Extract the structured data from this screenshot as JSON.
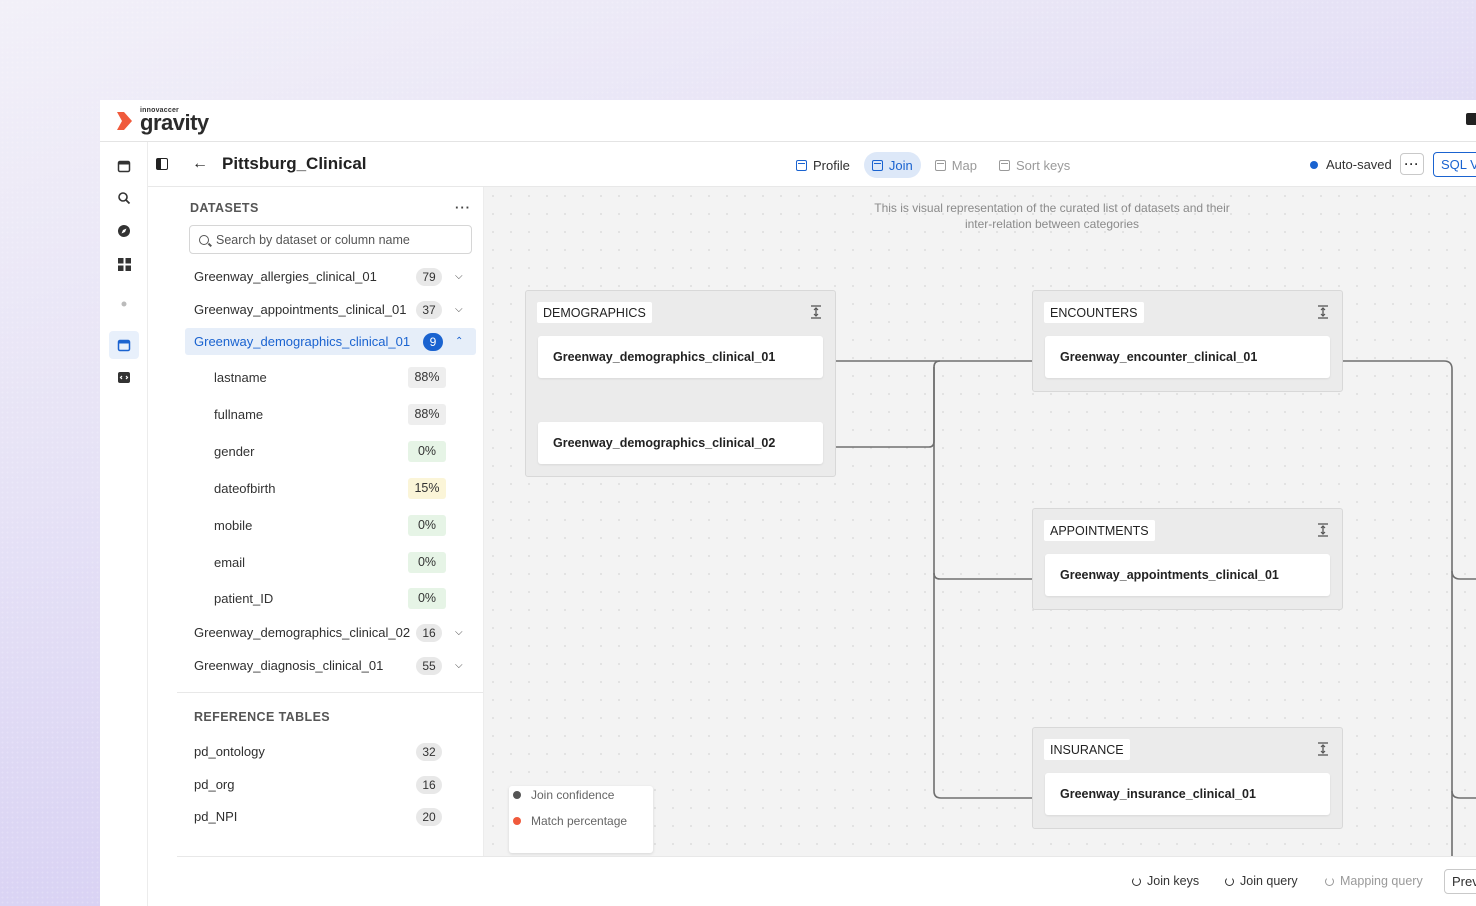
{
  "brand": {
    "small": "innovaccer",
    "name": "gravity",
    "accent": "#f05a3c"
  },
  "header": {
    "title": "Pittsburg_Clinical",
    "tabs": [
      {
        "label": "Profile",
        "state": "normal"
      },
      {
        "label": "Join",
        "state": "active"
      },
      {
        "label": "Map",
        "state": "disabled"
      },
      {
        "label": "Sort keys",
        "state": "disabled"
      }
    ],
    "status": "Auto-saved",
    "more": "···",
    "sql_button": "SQL V"
  },
  "datasets": {
    "title": "DATASETS",
    "menu": "···",
    "search_placeholder": "Search by dataset or column name",
    "items": [
      {
        "name": "Greenway_allergies_clinical_01",
        "count": "79"
      },
      {
        "name": "Greenway_appointments_clinical_01",
        "count": "37"
      },
      {
        "name": "Greenway_demographics_clinical_01",
        "count": "9"
      },
      {
        "name": "Greenway_demographics_clinical_02",
        "count": "16"
      },
      {
        "name": "Greenway_diagnosis_clinical_01",
        "count": "55"
      }
    ],
    "columns": [
      {
        "name": "lastname",
        "pct": "88%"
      },
      {
        "name": "fullname",
        "pct": "88%"
      },
      {
        "name": "gender",
        "pct": "0%"
      },
      {
        "name": "dateofbirth",
        "pct": "15%"
      },
      {
        "name": "mobile",
        "pct": "0%"
      },
      {
        "name": "email",
        "pct": "0%"
      },
      {
        "name": "patient_ID",
        "pct": "0%"
      }
    ]
  },
  "reference": {
    "title": "REFERENCE TABLES",
    "items": [
      {
        "name": "pd_ontology",
        "count": "32"
      },
      {
        "name": "pd_org",
        "count": "16"
      },
      {
        "name": "pd_NPI",
        "count": "20"
      }
    ]
  },
  "canvas": {
    "description": "This is visual representation of the curated list of datasets and their inter-relation between categories",
    "groups": [
      {
        "label": "DEMOGRAPHICS",
        "tables": [
          "Greenway_demographics_clinical_01",
          "Greenway_demographics_clinical_02"
        ]
      },
      {
        "label": "ENCOUNTERS",
        "tables": [
          "Greenway_encounter_clinical_01"
        ]
      },
      {
        "label": "APPOINTMENTS",
        "tables": [
          "Greenway_appointments_clinical_01"
        ]
      },
      {
        "label": "INSURANCE",
        "tables": [
          "Greenway_insurance_clinical_01"
        ]
      }
    ],
    "legend": [
      {
        "label": "Join confidence",
        "color": "#555555"
      },
      {
        "label": "Match percentage",
        "color": "#f05a3c"
      }
    ]
  },
  "footer": {
    "join_keys": "Join keys",
    "join_query": "Join query",
    "mapping_query": "Mapping query",
    "preview": "Prev"
  },
  "colors": {
    "primary": "#1a63d0",
    "active_bg": "#e6eef9"
  }
}
